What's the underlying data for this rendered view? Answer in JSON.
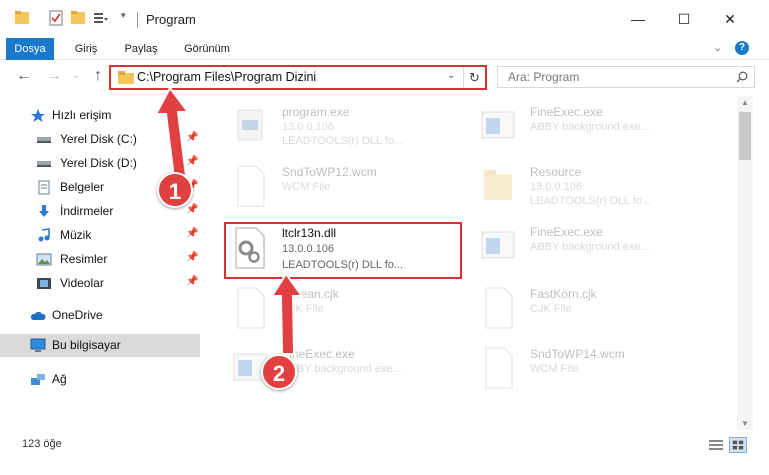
{
  "window": {
    "title": "Program",
    "controls": {
      "minimize": "—",
      "maximize": "☐",
      "close": "✕"
    }
  },
  "ribbon": {
    "tabs": [
      "Dosya",
      "Giriş",
      "Paylaş",
      "Görünüm"
    ],
    "help": "?"
  },
  "nav": {
    "address": "C:\\Program Files\\Program Dizini",
    "search_placeholder": "Ara: Program"
  },
  "sidebar": {
    "items": [
      {
        "label": "Hızlı erişim",
        "icon": "star-icon"
      },
      {
        "label": "Yerel Disk (C:)",
        "icon": "drive-icon"
      },
      {
        "label": "Yerel Disk (D:)",
        "icon": "drive-icon"
      },
      {
        "label": "Belgeler",
        "icon": "documents-icon"
      },
      {
        "label": "İndirmeler",
        "icon": "download-icon"
      },
      {
        "label": "Müzik",
        "icon": "music-icon"
      },
      {
        "label": "Resimler",
        "icon": "pictures-icon"
      },
      {
        "label": "Videolar",
        "icon": "video-icon"
      },
      {
        "label": "OneDrive",
        "icon": "cloud-icon"
      },
      {
        "label": "Bu bilgisayar",
        "icon": "computer-icon"
      },
      {
        "label": "Ağ",
        "icon": "network-icon"
      }
    ]
  },
  "files": [
    {
      "name": "program.exe",
      "line2": "13.0.0.106",
      "line3": "LEADTOOLS(r) DLL fo..."
    },
    {
      "name": "FineExec.exe",
      "line2": "ABBY background exe...",
      "line3": ""
    },
    {
      "name": "SndToWP12.wcm",
      "line2": "WCM File",
      "line3": ""
    },
    {
      "name": "Resource",
      "line2": "13.0.0.106",
      "line3": "LEADTOOLS(r) DLL fo..."
    },
    {
      "name": "ltclr13n.dll",
      "line2": "13.0.0.106",
      "line3": "LEADTOOLS(r) DLL fo..."
    },
    {
      "name": "FineExec.exe",
      "line2": "ABBY background exe...",
      "line3": ""
    },
    {
      "name": "Korean.cjk",
      "line2": "CJK File",
      "line3": ""
    },
    {
      "name": "FastKorn.cjk",
      "line2": "CJK File",
      "line3": ""
    },
    {
      "name": "FineExec.exe",
      "line2": "ABBY background exe...",
      "line3": ""
    },
    {
      "name": "SndToWP14.wcm",
      "line2": "WCM File",
      "line3": ""
    }
  ],
  "status": {
    "count": "123 öğe"
  },
  "annotations": {
    "step1": "1",
    "step2": "2"
  },
  "colors": {
    "accent": "#1979ca",
    "highlight": "#d93232",
    "badge": "#e04040"
  }
}
